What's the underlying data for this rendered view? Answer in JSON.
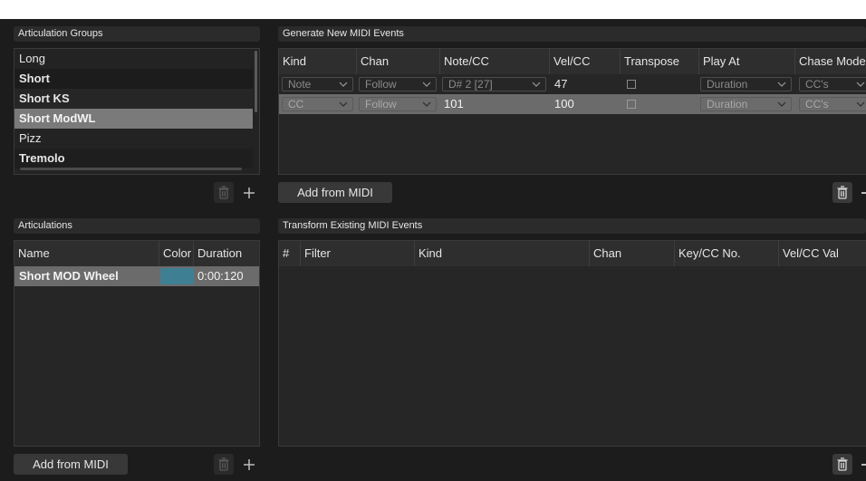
{
  "articulation_groups": {
    "header": "Articulation Groups",
    "items": [
      {
        "label": "Long",
        "bold": false
      },
      {
        "label": "Short",
        "bold": true
      },
      {
        "label": "Short KS",
        "bold": true
      },
      {
        "label": "Short ModWL",
        "bold": true,
        "selected": true
      },
      {
        "label": "Pizz",
        "bold": false
      },
      {
        "label": "Tremolo",
        "bold": true
      }
    ]
  },
  "generate": {
    "header": "Generate New MIDI Events",
    "columns": [
      "Kind",
      "Chan",
      "Note/CC",
      "Vel/CC",
      "Transpose",
      "Play At",
      "Chase Mode"
    ],
    "rows": [
      {
        "kind": "Note",
        "chan": "Follow",
        "note_cc": "D# 2 [27]",
        "vel_cc": "47",
        "transpose": false,
        "play_at": "Duration",
        "chase": "CC's"
      },
      {
        "kind": "CC",
        "chan": "Follow",
        "note_cc": "101",
        "vel_cc": "100",
        "transpose": false,
        "play_at": "Duration",
        "chase": "CC's"
      }
    ],
    "add_from_midi": "Add from MIDI"
  },
  "articulations": {
    "header": "Articulations",
    "columns": [
      "Name",
      "Color",
      "Duration"
    ],
    "rows": [
      {
        "name": "Short MOD Wheel",
        "color": "#3f7f94",
        "duration": "0:00:120"
      }
    ],
    "add_from_midi": "Add from MIDI"
  },
  "transform": {
    "header": "Transform Existing MIDI Events",
    "columns": [
      "#",
      "Filter",
      "Kind",
      "Chan",
      "Key/CC No.",
      "Vel/CC Val"
    ]
  },
  "icons": {
    "trash": "trash-icon",
    "plus": "plus-icon",
    "chevron": "chevron-down-icon"
  }
}
